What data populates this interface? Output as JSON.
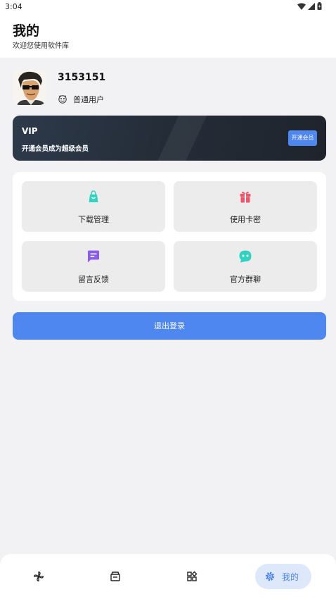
{
  "status_bar": {
    "time": "3:04",
    "icons": [
      "wifi-icon",
      "signal-icon",
      "battery-icon"
    ]
  },
  "header": {
    "title": "我的",
    "subtitle": "欢迎您使用软件库"
  },
  "profile": {
    "user_id": "3153151",
    "user_type": "普通用户",
    "user_type_icon": "user-type-icon"
  },
  "vip": {
    "title": "VIP",
    "description": "开通会员成为超级会员",
    "button_label": "开通会员"
  },
  "menu": {
    "items": [
      {
        "label": "下载管理",
        "icon": "shopping-bag-icon",
        "color": "#2fd3c0"
      },
      {
        "label": "使用卡密",
        "icon": "gift-icon",
        "color": "#f0566b"
      },
      {
        "label": "留言反馈",
        "icon": "message-icon",
        "color": "#8b5cf0"
      },
      {
        "label": "官方群聊",
        "icon": "chat-bot-icon",
        "color": "#2fd3c0"
      }
    ]
  },
  "logout": {
    "label": "退出登录"
  },
  "bottom_nav": {
    "items": [
      {
        "icon": "pinwheel-icon"
      },
      {
        "icon": "store-icon"
      },
      {
        "icon": "apps-icon"
      },
      {
        "icon": "settings-icon",
        "label": "我的",
        "active": true
      }
    ]
  },
  "colors": {
    "accent": "#4f87f0",
    "accent_light": "#dde8fb",
    "vip_bg": "#252d39"
  }
}
